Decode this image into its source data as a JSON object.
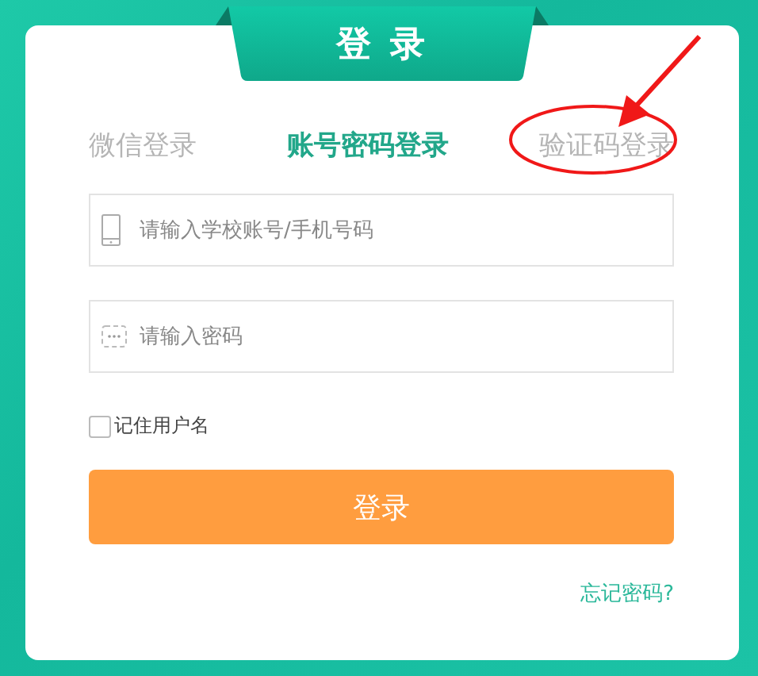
{
  "title": "登 录",
  "tabs": [
    {
      "label": "微信登录",
      "selected": false
    },
    {
      "label": "账号密码登录",
      "selected": true
    },
    {
      "label": "验证码登录",
      "selected": false
    }
  ],
  "fields": [
    {
      "kind": "phone",
      "placeholder": "请输入学校账号/手机号码"
    },
    {
      "kind": "password",
      "placeholder": "请输入密码"
    }
  ],
  "remember": {
    "label": "记住用户名",
    "checked": false
  },
  "login_button": "登录",
  "forgot_link": "忘记密码?"
}
